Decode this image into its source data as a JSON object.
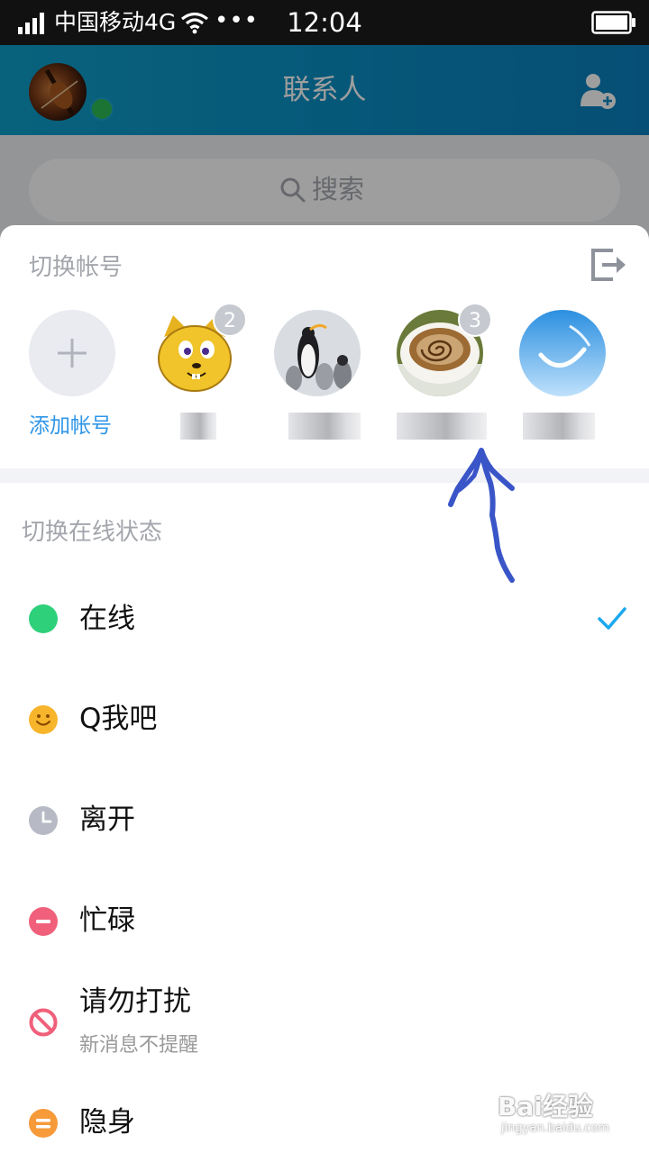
{
  "status_bar": {
    "carrier": "中国移动4G",
    "more": "•••",
    "time": "12:04",
    "icons": [
      "signal-icon",
      "wifi-icon",
      "battery-icon"
    ]
  },
  "header": {
    "title": "联系人",
    "icons": [
      "avatar",
      "online-status-dot",
      "add-contact-icon"
    ]
  },
  "search": {
    "label": "搜索",
    "icon": "search-icon"
  },
  "switch_account": {
    "title": "切换帐号",
    "logout_icon": "logout-icon",
    "add_label": "添加帐号",
    "accounts": [
      {
        "avatar": "cartoon-cat-avatar",
        "badge": "2"
      },
      {
        "avatar": "penguins-avatar",
        "badge": ""
      },
      {
        "avatar": "coffee-avatar",
        "badge": "3"
      },
      {
        "avatar": "sky-avatar",
        "badge": ""
      }
    ]
  },
  "online_status": {
    "title": "切换在线状态",
    "items": [
      {
        "label": "在线",
        "icon": "online-dot-icon",
        "color": "#2ed07a",
        "selected": true
      },
      {
        "label": "Q我吧",
        "icon": "smile-icon",
        "color": "#f7b52c"
      },
      {
        "label": "离开",
        "icon": "clock-icon",
        "color": "#b7bac4"
      },
      {
        "label": "忙碌",
        "icon": "busy-icon",
        "color": "#f0607a"
      },
      {
        "label": "请勿打扰",
        "sublabel": "新消息不提醒",
        "icon": "do-not-disturb-icon",
        "color": "#f0607a"
      },
      {
        "label": "隐身",
        "icon": "invisible-icon",
        "color": "#f79a3a"
      }
    ]
  },
  "watermark": {
    "logo": "Bai经验",
    "url": "jingyan.baidu.com"
  },
  "colors": {
    "accent": "#2f96e8",
    "check": "#1ba8ee",
    "annotation": "#3a55c8"
  }
}
